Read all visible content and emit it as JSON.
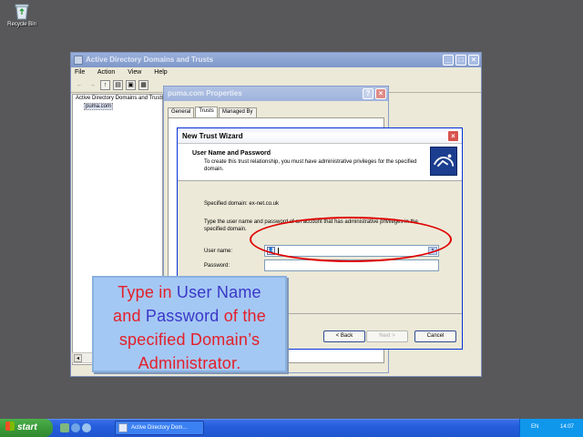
{
  "desktop": {
    "recycle_bin_label": "Recycle Bin"
  },
  "mmc_window": {
    "title": "Active Directory Domains and Trusts",
    "menu": [
      "File",
      "Action",
      "View",
      "Help"
    ],
    "tree": {
      "root": "Active Directory Domains and Trusts",
      "child": "puma.com"
    }
  },
  "properties_dialog": {
    "title": "puma.com Properties",
    "tabs": [
      "General",
      "Trusts",
      "Managed By"
    ],
    "selected_tab": "Trusts"
  },
  "wizard": {
    "title": "New Trust Wizard",
    "header_title": "User Name and Password",
    "header_subtitle": "To create this trust relationship, you must have administrative privileges for the specified domain.",
    "specified_domain": "Specified domain: ex-net.co.uk",
    "instruction": "Type the user name and password of an account that has administrative privileges in the specified domain.",
    "user_name_label": "User name:",
    "user_name_value": "",
    "password_label": "Password:",
    "password_value": "",
    "buttons": {
      "back": "< Back",
      "next": "Next >",
      "cancel": "Cancel"
    }
  },
  "callout": {
    "line1a": "Type in ",
    "line1b": "User Name",
    "line2a": "and ",
    "line2b": "Password",
    "line2c": " of the",
    "line3": "specified Domain’s",
    "line4": "Administrator."
  },
  "taskbar": {
    "start_label": "start",
    "task_label": "Active Directory Dom...",
    "language": "EN",
    "clock": "14:07"
  },
  "colors": {
    "desktop": "#58585a",
    "annotation_red": "#e00000",
    "callout_bg": "#a4c8f4",
    "callout_text_red": "#e3202a",
    "callout_text_blue": "#3a37c8",
    "taskbar_blue": "#245edb",
    "start_green": "#3c9a3a"
  }
}
